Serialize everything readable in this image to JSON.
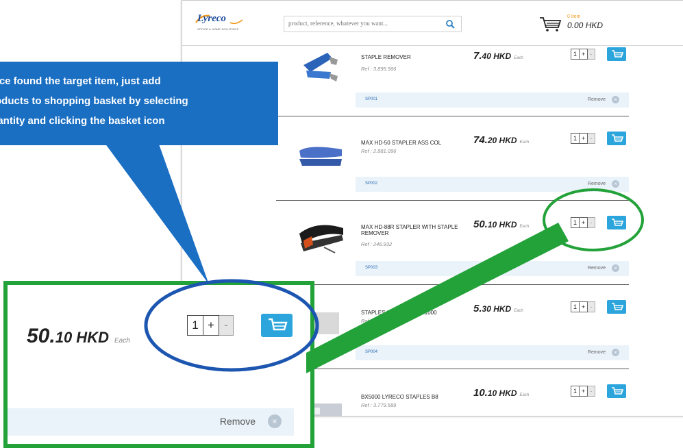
{
  "header": {
    "logo_text": "Lyreco",
    "logo_subtext": "OFFICE & HOME SOLUTIONS",
    "search_placeholder": "product, reference, whatever you want...",
    "cart_items": "0 Item",
    "cart_total": "0.00 HKD"
  },
  "products": [
    {
      "name": "STAPLE REMOVER",
      "ref": "Ref : 3.895.566",
      "price_int": "7.",
      "price_dec": "40 HKD",
      "each": "Each",
      "qty": "1",
      "plus": "+",
      "minus": "-",
      "code": "SP001",
      "remove": "Remove"
    },
    {
      "name": "MAX HD-50 STAPLER ASS COL",
      "ref": "Ref : 2.881.096",
      "price_int": "74.",
      "price_dec": "20 HKD",
      "each": "Each",
      "qty": "1",
      "plus": "+",
      "minus": "-",
      "code": "SP002",
      "remove": "Remove"
    },
    {
      "name": "MAX HD-88R STAPLER WITH STAPLE REMOVER",
      "ref": "Ref : 246.932",
      "price_int": "50.",
      "price_dec": "10 HKD",
      "each": "Each",
      "qty": "1",
      "plus": "+",
      "minus": "-",
      "code": "SP003",
      "remove": "Remove"
    },
    {
      "name": "STAPLES 26/6 - BOX OF 1000",
      "ref": "Ref : 5.002.556",
      "price_int": "5.",
      "price_dec": "30 HKD",
      "each": "Each",
      "qty": "1",
      "plus": "+",
      "minus": "-",
      "code": "SP004",
      "remove": "Remove"
    },
    {
      "name": "BX5000 LYRECO STAPLES B8",
      "ref": "Ref : 3.779.589",
      "price_int": "10.",
      "price_dec": "10 HKD",
      "each": "Each",
      "qty": "1",
      "plus": "+",
      "minus": "-",
      "code": "",
      "remove": ""
    }
  ],
  "callout": {
    "lines": [
      "Once found the target item, just add",
      "products to shopping basket by selecting",
      "quantity and clicking the basket icon"
    ]
  },
  "zoom": {
    "price_int": "50.",
    "price_dec": "10 HKD",
    "each": "Each",
    "qty": "1",
    "plus": "+",
    "minus": "-",
    "remove": "Remove"
  },
  "colors": {
    "callout_blue": "#1a6fc3",
    "highlight_green": "#23a23a",
    "basket_blue": "#2ba5dc",
    "ellipse_blue": "#1c56b0"
  }
}
